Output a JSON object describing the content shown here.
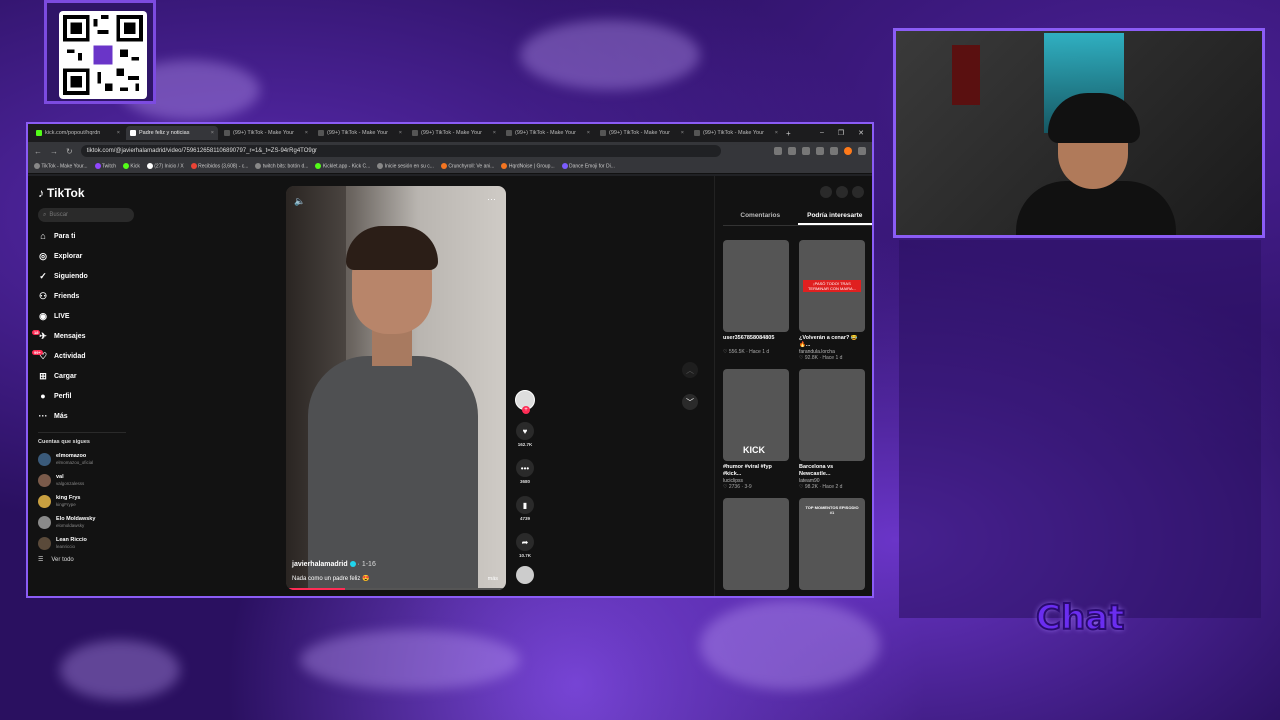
{
  "stream": {
    "chat_label": "Chat"
  },
  "browser": {
    "tabs": [
      {
        "label": "kick.com/popout/hqrdn",
        "active": false
      },
      {
        "label": "Padre feliz y noticias",
        "active": true
      },
      {
        "label": "(99+) TikTok - Make Your",
        "active": false
      },
      {
        "label": "(99+) TikTok - Make Your",
        "active": false
      },
      {
        "label": "(99+) TikTok - Make Your",
        "active": false
      },
      {
        "label": "(99+) TikTok - Make Your",
        "active": false
      },
      {
        "label": "(99+) TikTok - Make Your",
        "active": false
      },
      {
        "label": "(99+) TikTok - Make Your",
        "active": false
      }
    ],
    "url": "tiktok.com/@javierhalamadrid/video/7596126581106890797_r=1&_t=ZS-94rRg4TO9gr",
    "bookmarks": [
      "TikTok - Make Your...",
      "Twitch",
      "Kick",
      "(27) Inicio / X",
      "Recibidos (3,608) - c...",
      "twitch bits: botón d...",
      "Kicklet.app - Kick C...",
      "Inicie sesión en su c...",
      "Crunchyroll: Ve ani...",
      "HqrdNoise | Group...",
      "Dance Emoji for Di..."
    ]
  },
  "tiktok": {
    "logo": "TikTok",
    "search_placeholder": "Buscar",
    "menu": [
      {
        "label": "Para ti",
        "icon": "home-icon"
      },
      {
        "label": "Explorar",
        "icon": "compass-icon"
      },
      {
        "label": "Siguiendo",
        "icon": "following-icon"
      },
      {
        "label": "Friends",
        "icon": "friends-icon"
      },
      {
        "label": "LIVE",
        "icon": "live-icon"
      },
      {
        "label": "Mensajes",
        "icon": "message-icon",
        "badge": "18"
      },
      {
        "label": "Actividad",
        "icon": "activity-icon",
        "badge": "99+"
      },
      {
        "label": "Cargar",
        "icon": "upload-icon"
      },
      {
        "label": "Perfil",
        "icon": "profile-icon"
      },
      {
        "label": "Más",
        "icon": "more-icon"
      }
    ],
    "following_title": "Cuentas que sigues",
    "following": [
      {
        "name": "elmomazoo",
        "handle": "elmomazoo_oficial"
      },
      {
        "name": "val",
        "handle": "valgonzalesss"
      },
      {
        "name": "king Frys",
        "handle": "kingFrype"
      },
      {
        "name": "Elo Moldawsky",
        "handle": "elomoldawsky"
      },
      {
        "name": "Lean Riccio",
        "handle": "leanriccio"
      }
    ],
    "see_all": "Ver todo",
    "video": {
      "username": "javierhalamadrid",
      "date": "· 1-16",
      "caption": "Nada como un padre feliz 😍",
      "more": "más",
      "progress": 0.27
    },
    "actions": {
      "likes": "162.7K",
      "comments": "3680",
      "saves": "4739",
      "shares": "10.7K"
    },
    "panel_tabs": [
      {
        "label": "Comentarios",
        "active": false
      },
      {
        "label": "Podría interesarte",
        "active": true
      }
    ],
    "recommended": [
      {
        "title": "user3567858084805",
        "user": "",
        "meta": "♡ 556.5K · Hace 1 d",
        "theme": "th1"
      },
      {
        "title": "¿Volverán a cenar? 😂🔥...",
        "user": "farandula.lorcha",
        "meta": "♡ 92.8K · Hace 1 d",
        "theme": "th2",
        "overlay": "¡PASÓ TODO! TRAS TERMINAR CON MAIRA..."
      },
      {
        "title": "#humor #viral #fyp #kick...",
        "user": "luciclipss",
        "meta": "♡ 2736 · 3-9",
        "theme": "th3",
        "overlay_kick": "KICK"
      },
      {
        "title": "Barcelona vs Newcastle...",
        "user": "lateam90",
        "meta": "♡ 98.2K · Hace 2 d",
        "theme": "th4"
      },
      {
        "title": "",
        "user": "",
        "meta": "",
        "theme": "th5"
      },
      {
        "title": "",
        "user": "",
        "meta": "",
        "theme": "th6",
        "overlay": "TOP MOMENTOS EPISODIO #1"
      }
    ]
  }
}
